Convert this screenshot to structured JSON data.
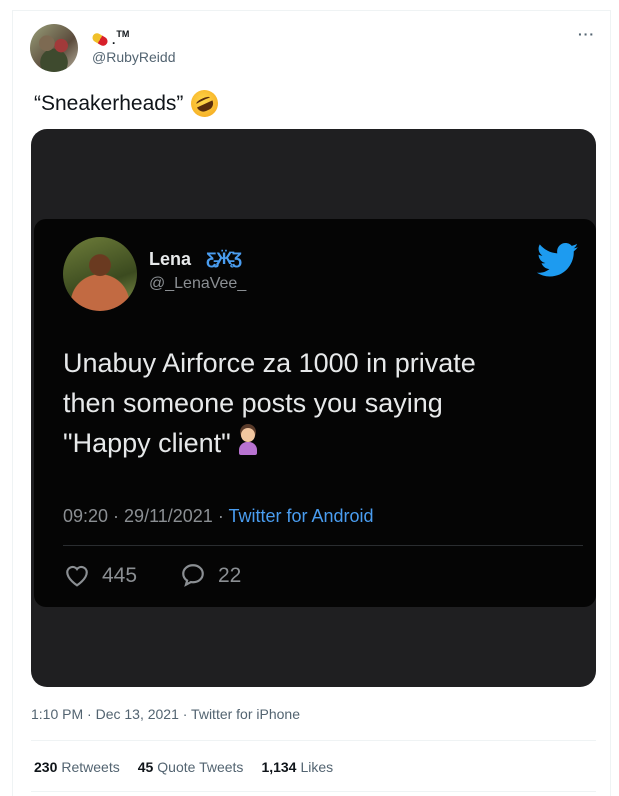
{
  "author": {
    "display_name_suffix": ".",
    "tm": "TM",
    "handle": "@RubyReidd",
    "avatar_icon": "profile-photo",
    "name_icon": "pill-emoji"
  },
  "tweet": {
    "text": "“Sneakerheads”",
    "emoji": "rofl-emoji",
    "more_label": "···"
  },
  "embedded": {
    "name": "Lena",
    "verified_icon": "butterfly-emoji",
    "handle": "@_LenaVee_",
    "text": "Unabuy Airforce za 1000 in private\nthen someone posts you saying\n\"Happy client\"",
    "text_emoji": "woman-facepalming-emoji",
    "time": "09:20",
    "sep1": " · ",
    "date": "29/11/2021",
    "sep2": " · ",
    "source": "Twitter for Android",
    "likes": "445",
    "replies": "22",
    "brand_color": "#1d9bf0"
  },
  "footer": {
    "timestamp": "1:10 PM · Dec 13, 2021 · Twitter for iPhone",
    "retweets_count": "230",
    "retweets_label": "Retweets",
    "quotes_count": "45",
    "quotes_label": "Quote Tweets",
    "likes_count": "1,134",
    "likes_label": "Likes"
  }
}
